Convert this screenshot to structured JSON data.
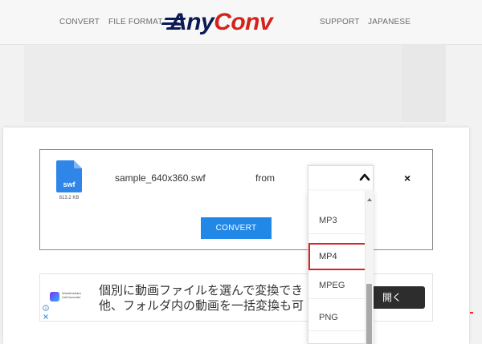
{
  "header": {
    "nav_left": [
      "CONVERT",
      "FILE FORMAT"
    ],
    "nav_right": [
      "SUPPORT",
      "JAPANESE"
    ],
    "logo_text_any": "Any",
    "logo_text_conv": "Conv"
  },
  "file": {
    "icon_label": "swf",
    "size": "813.2 KB",
    "name": "sample_640x360.swf",
    "from_label": "from",
    "remove_symbol": "×"
  },
  "convert_button": "CONVERT",
  "dropdown": {
    "options": [
      "MP3",
      "MP4",
      "MPEG",
      "PNG"
    ],
    "selected": "MP4"
  },
  "ad": {
    "brand_line1": "Wondershare",
    "brand_line2": "UniConverter",
    "text_line1": "個別に動画ファイルを選んで変換でき",
    "text_line2": "他、フォルダ内の動画を一括変換も可",
    "open_button": "開く"
  },
  "colors": {
    "brand_blue": "#0c1a55",
    "brand_red": "#d4231b",
    "convert_blue": "#2288e8",
    "selected_border": "#d9232b",
    "file_icon": "#2f86e8"
  }
}
